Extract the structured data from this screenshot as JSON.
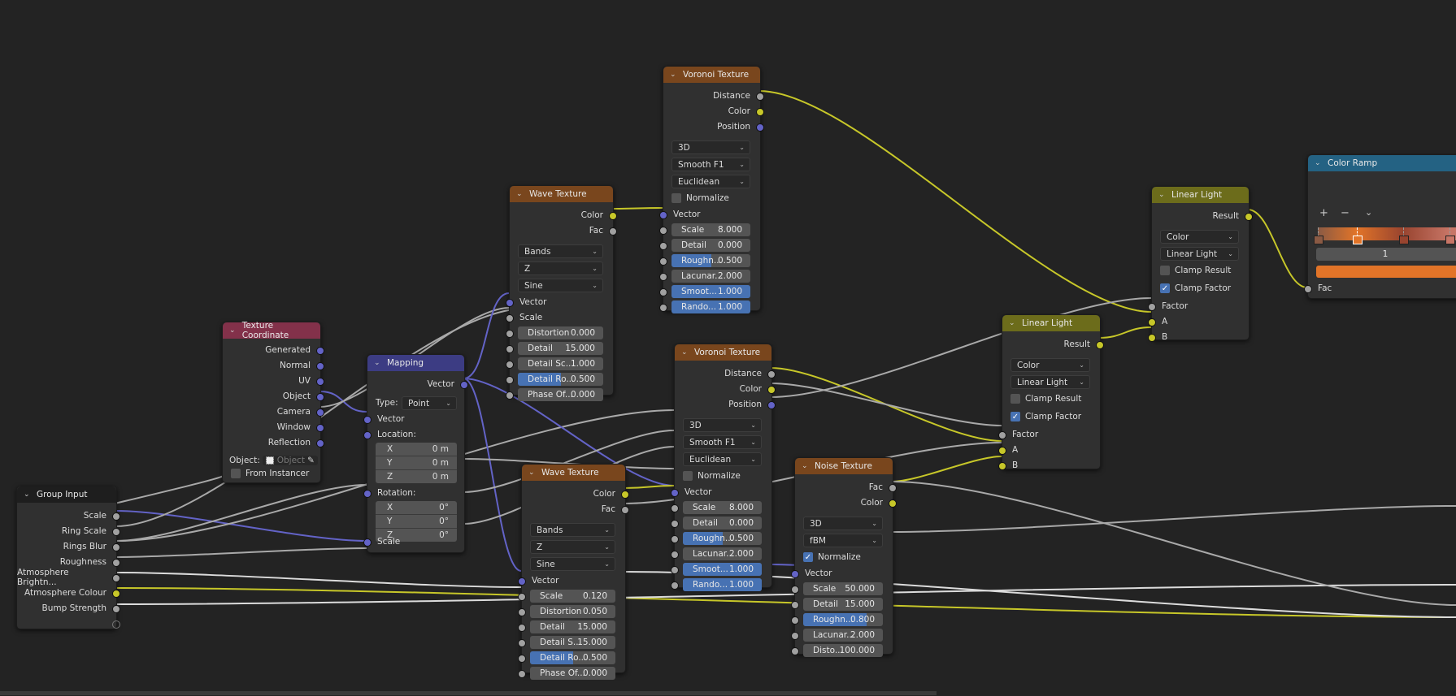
{
  "colors": {
    "background": "#232323",
    "node_body": "#303030",
    "header_input": "#1e1e1e",
    "header_texcoord": "#83314a",
    "header_vector": "#3c3c83",
    "header_texture": "#79461d",
    "header_color": "#6c6c1b",
    "header_converter": "#246283",
    "socket_float": "#a1a1a1",
    "socket_vector": "#6363c7",
    "socket_color": "#c7c729",
    "slider_fill": "#4772b3",
    "ramp_selected_color": "#e27428"
  },
  "nodes": {
    "group_input": {
      "title": "Group Input",
      "outputs": [
        "Scale",
        "Ring Scale",
        "Rings Blur",
        "Roughness",
        "Atmosphere Brightn...",
        "Atmosphere Colour",
        "Bump Strength"
      ]
    },
    "texture_coordinate": {
      "title": "Texture Coordinate",
      "outputs": [
        "Generated",
        "Normal",
        "UV",
        "Object",
        "Camera",
        "Window",
        "Reflection"
      ],
      "object_label": "Object:",
      "object_placeholder": "Object",
      "from_instancer": "From Instancer"
    },
    "mapping": {
      "title": "Mapping",
      "output": "Vector",
      "type_label": "Type:",
      "type_value": "Point",
      "vector_input": "Vector",
      "location_label": "Location:",
      "location": [
        {
          "k": "X",
          "v": "0 m"
        },
        {
          "k": "Y",
          "v": "0 m"
        },
        {
          "k": "Z",
          "v": "0 m"
        }
      ],
      "rotation_label": "Rotation:",
      "rotation": [
        {
          "k": "X",
          "v": "0°"
        },
        {
          "k": "Y",
          "v": "0°"
        },
        {
          "k": "Z",
          "v": "0°"
        }
      ],
      "scale_input": "Scale"
    },
    "wave_1": {
      "title": "Wave Texture",
      "outputs": [
        "Color",
        "Fac"
      ],
      "dropdowns": [
        "Bands",
        "Z",
        "Sine"
      ],
      "inputs": [
        "Vector",
        "Scale"
      ],
      "fields": [
        {
          "label": "Distortion",
          "value": "0.000",
          "fill": 0
        },
        {
          "label": "Detail",
          "value": "15.000",
          "fill": 0
        },
        {
          "label": "Detail Sc...",
          "value": "1.000",
          "fill": 0
        },
        {
          "label": "Detail Ro...",
          "value": "0.500",
          "fill": 0.5
        },
        {
          "label": "Phase Of...",
          "value": "0.000",
          "fill": 0
        }
      ]
    },
    "voronoi_1": {
      "title": "Voronoi Texture",
      "outputs": [
        "Distance",
        "Color",
        "Position"
      ],
      "dropdowns": [
        "3D",
        "Smooth F1",
        "Euclidean"
      ],
      "normalize": "Normalize",
      "vector_input": "Vector",
      "fields": [
        {
          "label": "Scale",
          "value": "8.000",
          "fill": 0
        },
        {
          "label": "Detail",
          "value": "0.000",
          "fill": 0
        },
        {
          "label": "Roughn...",
          "value": "0.500",
          "fill": 0.5
        },
        {
          "label": "Lacunar...",
          "value": "2.000",
          "fill": 0
        },
        {
          "label": "Smoot...",
          "value": "1.000",
          "fill": 1
        },
        {
          "label": "Rando...",
          "value": "1.000",
          "fill": 1
        }
      ]
    },
    "wave_2": {
      "title": "Wave Texture",
      "outputs": [
        "Color",
        "Fac"
      ],
      "dropdowns": [
        "Bands",
        "Z",
        "Sine"
      ],
      "vector_input": "Vector",
      "fields": [
        {
          "label": "Scale",
          "value": "0.120",
          "fill": 0
        },
        {
          "label": "Distortion",
          "value": "0.050",
          "fill": 0
        },
        {
          "label": "Detail",
          "value": "15.000",
          "fill": 0
        },
        {
          "label": "Detail S...",
          "value": "15.000",
          "fill": 0
        },
        {
          "label": "Detail Ro...",
          "value": "0.500",
          "fill": 0.5
        },
        {
          "label": "Phase Of...",
          "value": "0.000",
          "fill": 0
        }
      ]
    },
    "voronoi_2": {
      "title": "Voronoi Texture",
      "outputs": [
        "Distance",
        "Color",
        "Position"
      ],
      "dropdowns": [
        "3D",
        "Smooth F1",
        "Euclidean"
      ],
      "normalize": "Normalize",
      "vector_input": "Vector",
      "fields": [
        {
          "label": "Scale",
          "value": "8.000",
          "fill": 0
        },
        {
          "label": "Detail",
          "value": "0.000",
          "fill": 0
        },
        {
          "label": "Roughn...",
          "value": "0.500",
          "fill": 0.5
        },
        {
          "label": "Lacunar...",
          "value": "2.000",
          "fill": 0
        },
        {
          "label": "Smoot...",
          "value": "1.000",
          "fill": 1
        },
        {
          "label": "Rando...",
          "value": "1.000",
          "fill": 1
        }
      ]
    },
    "noise": {
      "title": "Noise Texture",
      "outputs": [
        "Fac",
        "Color"
      ],
      "dropdowns": [
        "3D",
        "fBM"
      ],
      "normalize": "Normalize",
      "vector_input": "Vector",
      "fields": [
        {
          "label": "Scale",
          "value": "50.000",
          "fill": 0
        },
        {
          "label": "Detail",
          "value": "15.000",
          "fill": 0
        },
        {
          "label": "Roughn...",
          "value": "0.800",
          "fill": 0.8
        },
        {
          "label": "Lacunar...",
          "value": "2.000",
          "fill": 0
        },
        {
          "label": "Disto...",
          "value": "100.000",
          "fill": 0
        }
      ]
    },
    "linear_light_2": {
      "title": "Linear Light",
      "output": "Result",
      "dropdowns": [
        "Color",
        "Linear Light"
      ],
      "clamp_result": "Clamp Result",
      "clamp_factor": "Clamp Factor",
      "inputs": [
        "Factor",
        "A",
        "B"
      ]
    },
    "linear_light_1": {
      "title": "Linear Light",
      "output": "Result",
      "dropdowns": [
        "Color",
        "Linear Light"
      ],
      "clamp_result": "Clamp Result",
      "clamp_factor": "Clamp Factor",
      "inputs": [
        "Factor",
        "A",
        "B"
      ]
    },
    "color_ramp": {
      "title": "Color Ramp",
      "add": "+",
      "remove": "−",
      "menu": "⌄",
      "active_index": "1",
      "input": "Fac",
      "stops": [
        {
          "pos": 0.0,
          "color": "#8a5a44"
        },
        {
          "pos": 0.25,
          "color": "#e27428"
        },
        {
          "pos": 0.55,
          "color": "#98442f"
        },
        {
          "pos": 0.85,
          "color": "#c77566"
        }
      ]
    }
  }
}
